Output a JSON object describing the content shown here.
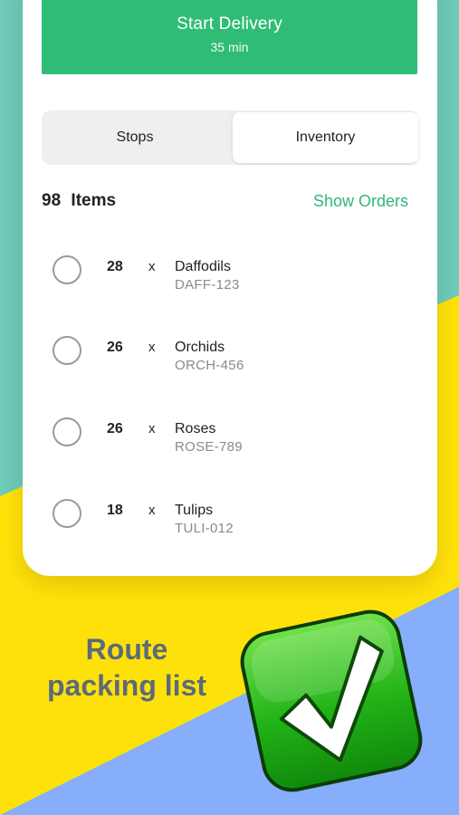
{
  "colors": {
    "teal_bg": "#6fcab8",
    "yellow_bg": "#ffe10a",
    "blue_bg": "#86aefb",
    "accent_green": "#2fbd75",
    "caption_text": "#5a6b7a"
  },
  "start_delivery": {
    "label": "Start Delivery",
    "duration": "35 min"
  },
  "tabs": [
    {
      "label": "Stops",
      "selected": false
    },
    {
      "label": "Inventory",
      "selected": true
    }
  ],
  "summary": {
    "count": "98",
    "label": "Items",
    "show_orders": "Show Orders"
  },
  "items": [
    {
      "qty": "28",
      "times": "x",
      "name": "Daffodils",
      "sku": "DAFF-123"
    },
    {
      "qty": "26",
      "times": "x",
      "name": "Orchids",
      "sku": "ORCH-456"
    },
    {
      "qty": "26",
      "times": "x",
      "name": "Roses",
      "sku": "ROSE-789"
    },
    {
      "qty": "18",
      "times": "x",
      "name": "Tulips",
      "sku": "TULI-012"
    }
  ],
  "caption": {
    "line1": "Route",
    "line2": "packing list"
  },
  "icons": {
    "item_checkbox": "radio-circle-icon",
    "badge": "check-mark-icon"
  }
}
